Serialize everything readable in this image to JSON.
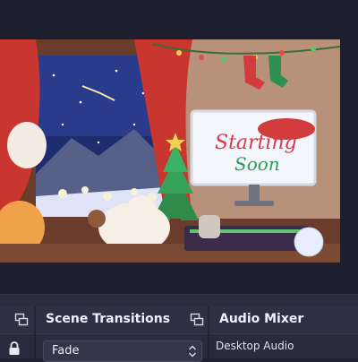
{
  "preview": {
    "sign_line1": "Starting",
    "sign_line2": "Soon"
  },
  "docks": {
    "scene_transitions": {
      "title": "Scene Transitions",
      "transition_value": "Fade"
    },
    "audio_mixer": {
      "title": "Audio Mixer",
      "first_source": "Desktop Audio"
    }
  },
  "icons": {
    "popout": "popout-icon",
    "lock": "lock-icon",
    "spinner": "up-down-arrows-icon"
  },
  "colors": {
    "window_bg": "#212231",
    "panel_bg": "#2a2b3c",
    "panel_header": "#2f3044",
    "sign_red": "#d9394b",
    "sign_green": "#2d9a58"
  }
}
